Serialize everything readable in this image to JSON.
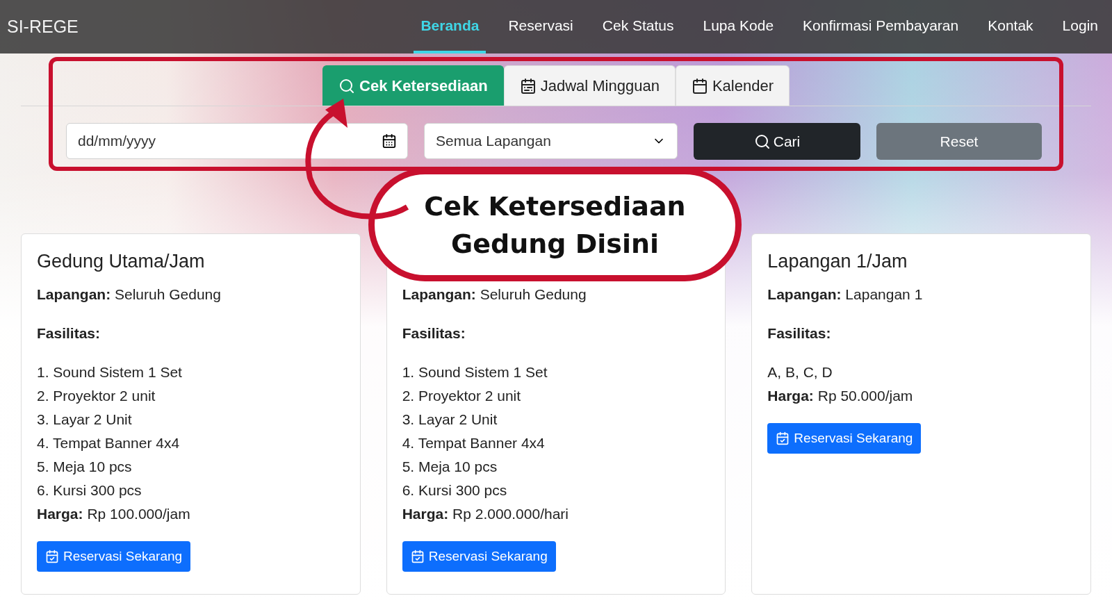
{
  "navbar": {
    "brand": "SI-REGE",
    "links": [
      {
        "label": "Beranda",
        "selected": true
      },
      {
        "label": "Reservasi",
        "selected": false
      },
      {
        "label": "Cek Status",
        "selected": false
      },
      {
        "label": "Lupa Kode",
        "selected": false
      },
      {
        "label": "Konfirmasi Pembayaran",
        "selected": false
      },
      {
        "label": "Kontak",
        "selected": false
      },
      {
        "label": "Login",
        "selected": false
      }
    ]
  },
  "tabs": [
    {
      "label": "Cek Ketersediaan",
      "selected": true,
      "kind": "search"
    },
    {
      "label": "Jadwal Mingguan",
      "selected": false,
      "kind": "week"
    },
    {
      "label": "Kalender",
      "selected": false,
      "kind": "calendar"
    }
  ],
  "filters": {
    "date": {
      "placeholder": "dd/mm/yyyy"
    },
    "court_select": {
      "value": "Semua Lapangan"
    },
    "search_button": "Cari",
    "reset_button": "Reset"
  },
  "callout": {
    "lines": [
      "Cek Ketersediaan",
      "Gedung Disini"
    ]
  },
  "cards": [
    {
      "title": "Gedung Utama/Jam",
      "court_label": "Lapangan:",
      "court": "Seluruh Gedung",
      "facilities_label": "Fasilitas:",
      "facilities": [
        "1. Sound Sistem 1 Set",
        "2. Proyektor 2 unit",
        "3. Layar 2 Unit",
        "4. Tempat Banner 4x4",
        "5. Meja 10 pcs",
        "6. Kursi 300 pcs"
      ],
      "price_label": "Harga:",
      "price": "Rp 100.000/jam",
      "button": "Reservasi Sekarang"
    },
    {
      "court_label": "Lapangan:",
      "court": "Seluruh Gedung",
      "facilities_label": "Fasilitas:",
      "facilities": [
        "1. Sound Sistem 1 Set",
        "2. Proyektor 2 unit",
        "3. Layar 2 Unit",
        "4. Tempat Banner 4x4",
        "5. Meja 10 pcs",
        "6. Kursi 300 pcs"
      ],
      "price_label": "Harga:",
      "price": "Rp 2.000.000/hari",
      "button": "Reservasi Sekarang"
    },
    {
      "title": "Lapangan 1/Jam",
      "court_label": "Lapangan:",
      "court": "Lapangan 1",
      "facilities_label": "Fasilitas:",
      "facilities": [
        "A, B, C, D"
      ],
      "price_label": "Harga:",
      "price": "Rp 50.000/jam",
      "button": "Reservasi Sekarang"
    }
  ]
}
